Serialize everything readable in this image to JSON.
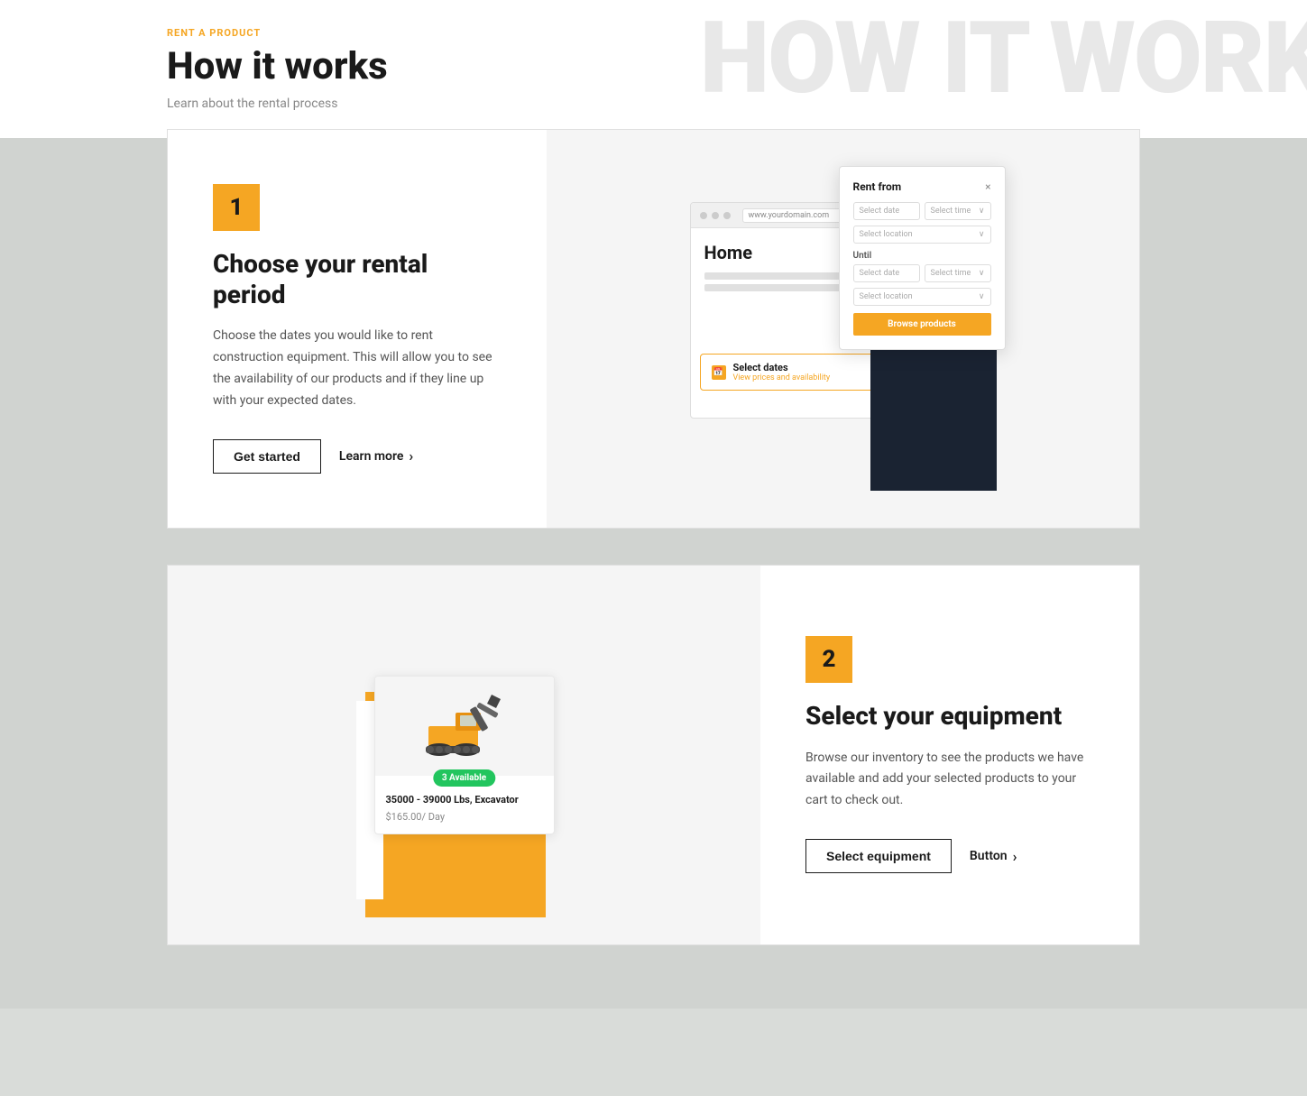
{
  "header": {
    "rent_label": "RENT A PRODUCT",
    "title": "How it works",
    "subtitle": "Learn about the rental process",
    "bg_text": "HOW IT WORK"
  },
  "step1": {
    "number": "1",
    "title": "Choose your rental period",
    "description": "Choose the dates you would like to rent construction equipment. This will allow you to see the availability of our products and if they line up with your expected dates.",
    "btn_primary": "Get started",
    "btn_link": "Learn more",
    "modal": {
      "title": "Rent from",
      "close": "×",
      "date_placeholder": "Select date",
      "time_placeholder": "Select time",
      "location_placeholder": "Select location",
      "until_label": "Until",
      "browse_btn": "Browse products"
    },
    "select_dates": {
      "main": "Select dates",
      "sub": "View prices and availability"
    },
    "browser_url": "www.yourdomain.com",
    "browser_home": "Home"
  },
  "step2": {
    "number": "2",
    "title": "Select your equipment",
    "description": "Browse our inventory to see the products we have available and add your selected products to your cart to check out.",
    "btn_primary": "Select equipment",
    "btn_link": "Button",
    "equipment": {
      "name": "35000 - 39000 Lbs, Excavator",
      "price": "$165.00",
      "unit": "/ Day",
      "available": "3 Available"
    }
  }
}
